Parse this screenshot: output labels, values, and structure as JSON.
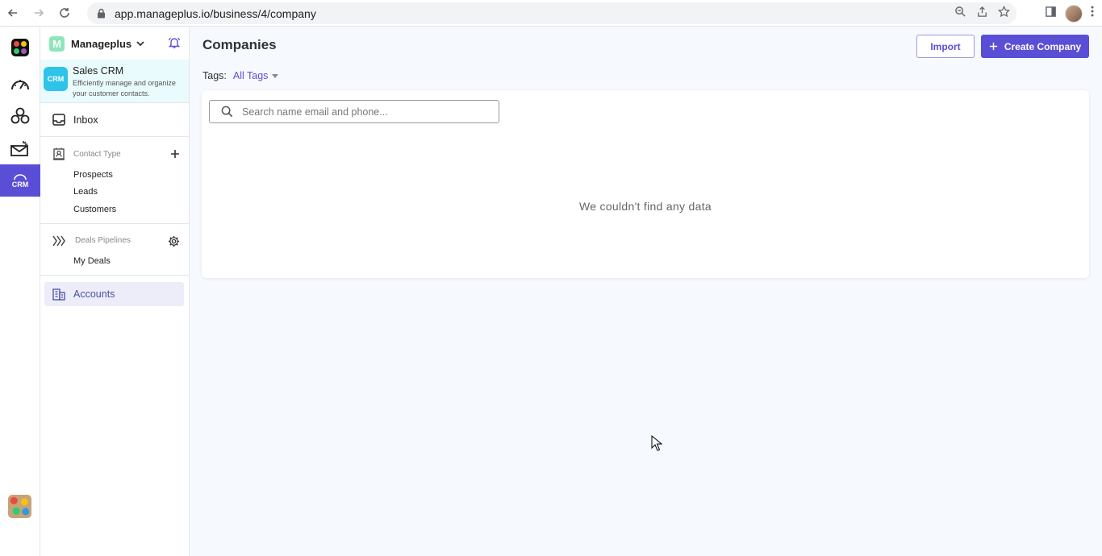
{
  "browser": {
    "url": "app.manageplus.io/business/4/company"
  },
  "workspace": {
    "badge": "M",
    "name": "Manageplus"
  },
  "app": {
    "logo_text": "CRM",
    "title": "Sales CRM",
    "description": "Efficiently manage and organize your customer contacts."
  },
  "rail": {
    "crm_label": "CRM"
  },
  "sidebar": {
    "inbox_label": "Inbox",
    "contact_type_label": "Contact Type",
    "contact_types": [
      "Prospects",
      "Leads",
      "Customers"
    ],
    "deals_label": "Deals Pipelines",
    "deals": [
      "My Deals"
    ],
    "accounts_label": "Accounts"
  },
  "header": {
    "title": "Companies",
    "import_label": "Import",
    "create_label": "Create Company"
  },
  "filters": {
    "tags_label": "Tags:",
    "tags_value": "All Tags"
  },
  "search": {
    "placeholder": "Search name email and phone..."
  },
  "empty_state": {
    "message": "We couldn't find any data"
  },
  "colors": {
    "accent": "#5b4ed6",
    "app_card_bg": "#e9fbfc",
    "page_bg": "#f6f9fd"
  }
}
